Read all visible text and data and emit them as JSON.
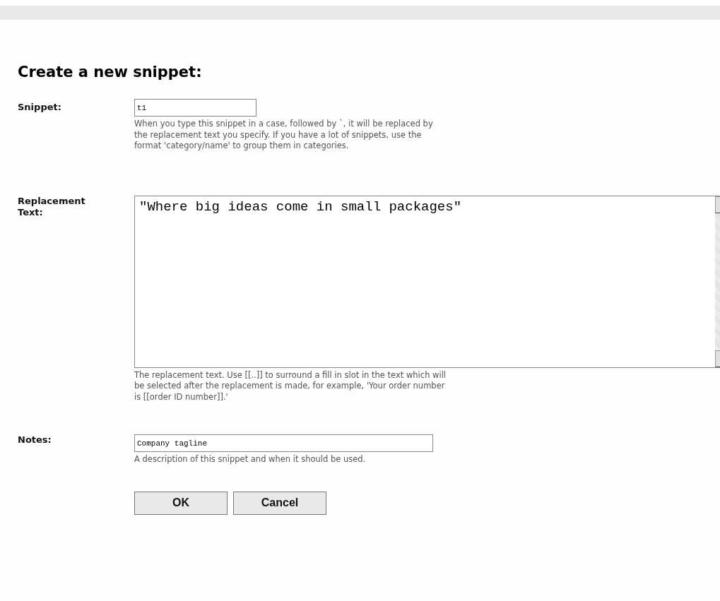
{
  "dialog": {
    "title": "Create a new snippet:",
    "fields": [
      {
        "kind": "input",
        "label": "Snippet:",
        "value": "t1",
        "help": "When you type this snippet in a case, followed by `, it will be replaced by the replacement text you specify. If you have a lot of snippets, use the format 'category/name' to group them in categories."
      },
      {
        "kind": "textarea",
        "label": "Replacement Text:",
        "value": "\"Where big ideas come in small packages\"",
        "help": "The replacement text. Use [[..]] to surround a fill in slot in the text which will be selected after the replacement is made, for example, 'Your order number is [[order ID number]].'"
      },
      {
        "kind": "wide-input",
        "label": "Notes:",
        "value": "Company tagline",
        "help": "A description of this snippet and when it should be used."
      }
    ],
    "buttons": [
      "OK",
      "Cancel"
    ]
  }
}
